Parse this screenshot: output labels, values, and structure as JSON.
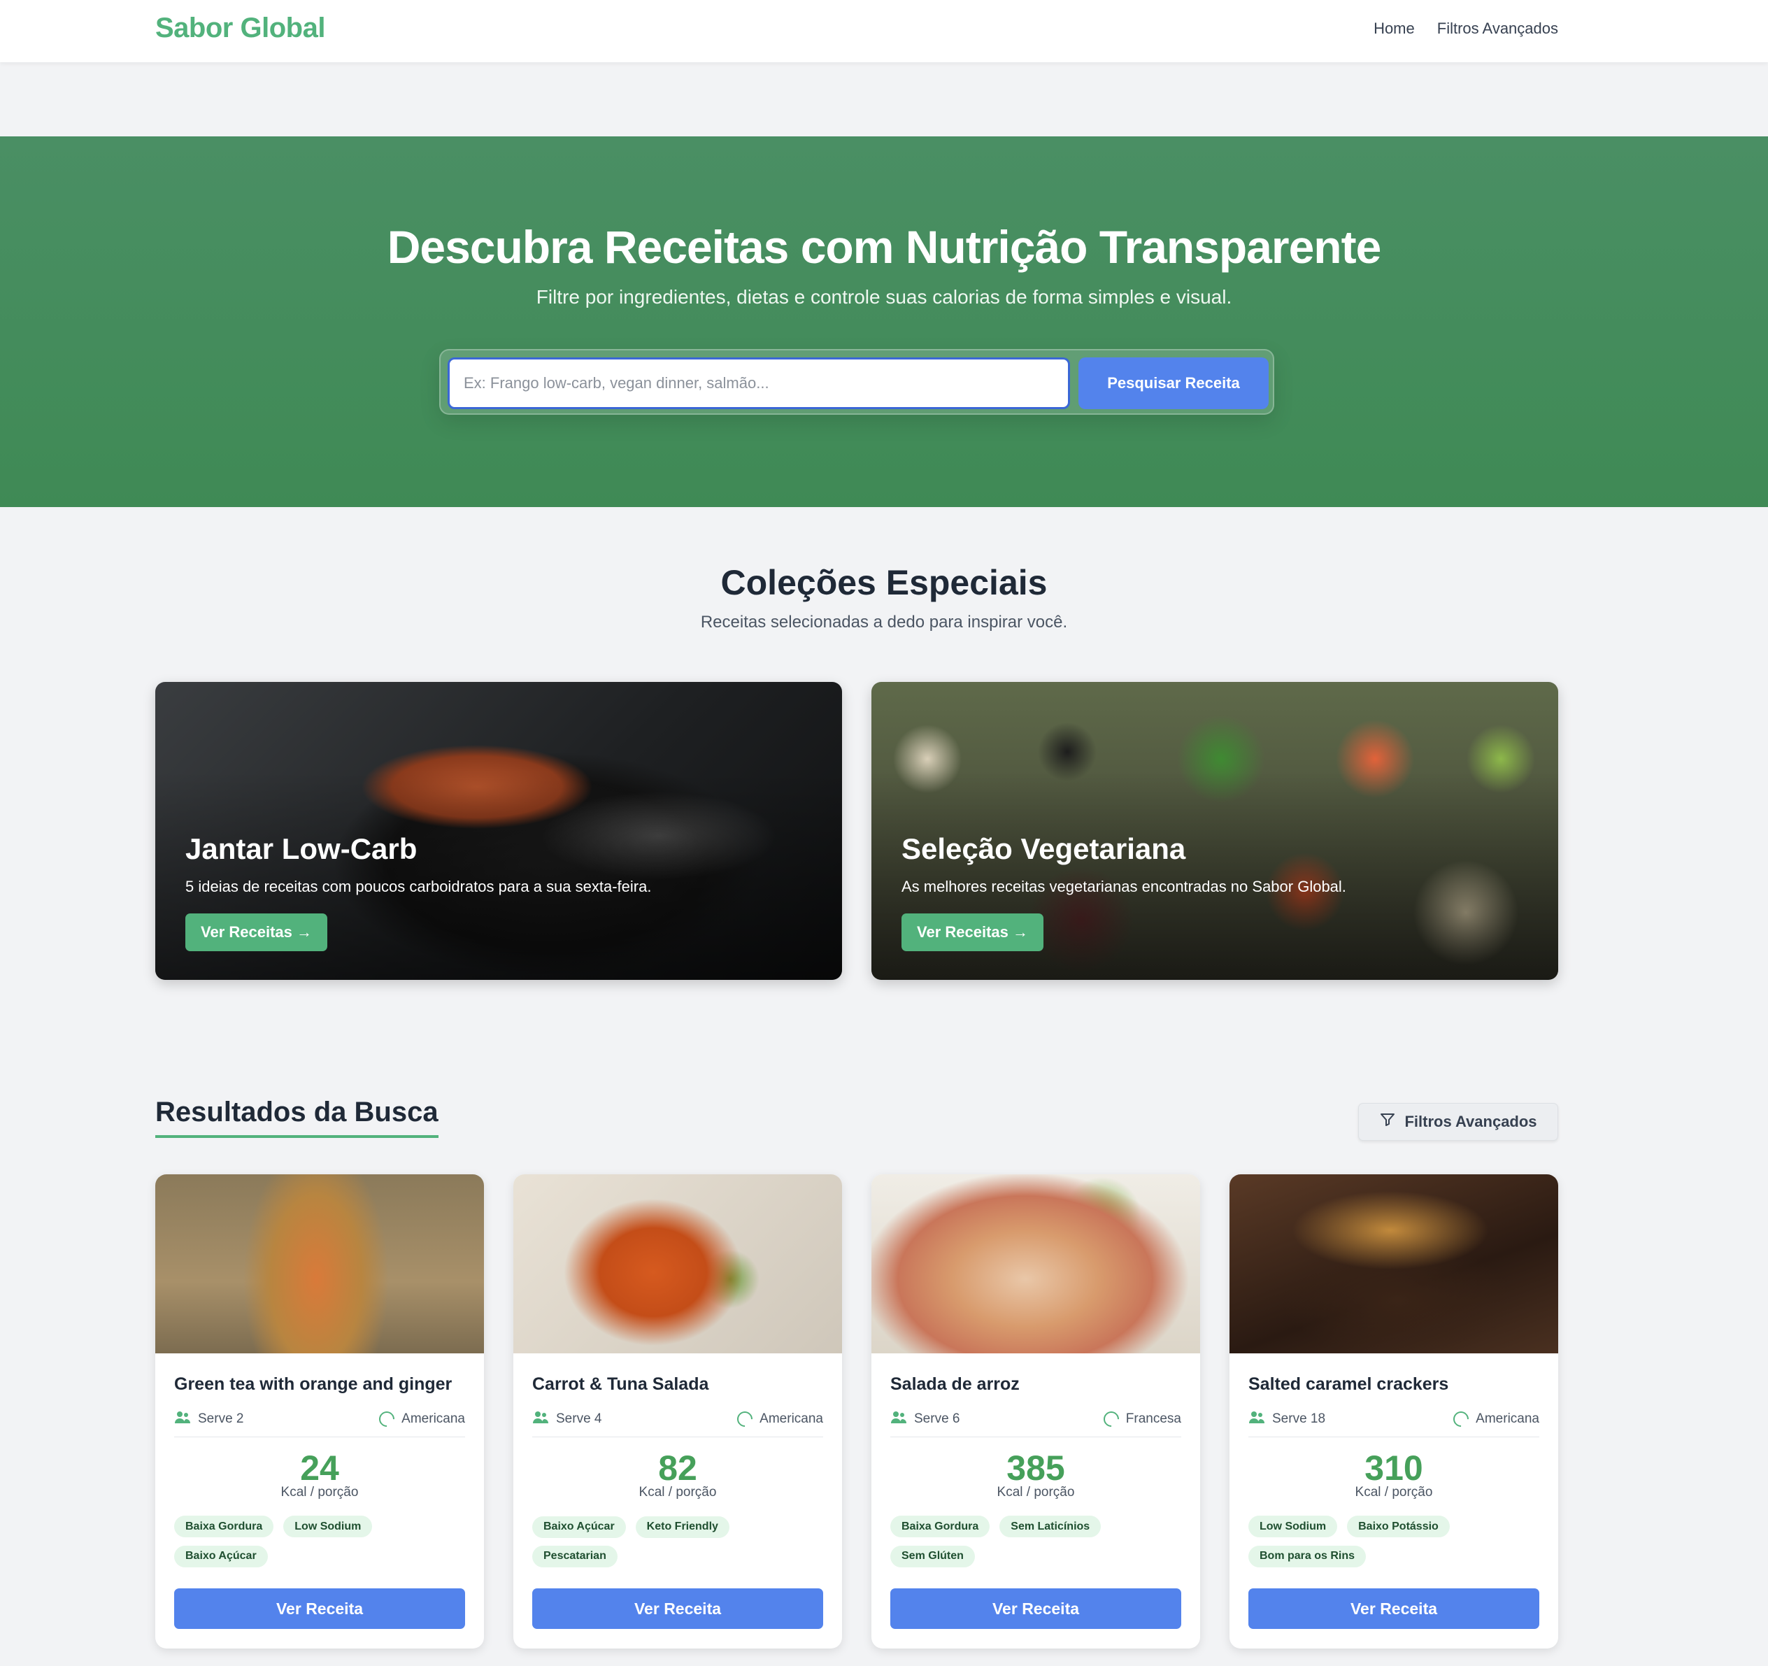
{
  "brand": "Sabor Global",
  "nav": {
    "home": "Home",
    "filters": "Filtros Avançados"
  },
  "hero": {
    "title": "Descubra Receitas com Nutrição Transparente",
    "subtitle": "Filtre por ingredientes, dietas e controle suas calorias de forma simples e visual.",
    "search_placeholder": "Ex: Frango low-carb, vegan dinner, salmão...",
    "search_value": "",
    "search_button": "Pesquisar Receita"
  },
  "collections": {
    "title": "Coleções Especiais",
    "subtitle": "Receitas selecionadas a dedo para inspirar você.",
    "items": [
      {
        "title": "Jantar Low-Carb",
        "description": "5 ideias de receitas com poucos carboidratos para a sua sexta-feira.",
        "button": "Ver Receitas →"
      },
      {
        "title": "Seleção Vegetariana",
        "description": "As melhores receitas vegetarianas encontradas no Sabor Global.",
        "button": "Ver Receitas →"
      }
    ]
  },
  "results": {
    "title": "Resultados da Busca",
    "filter_button": "Filtros Avançados",
    "cards": [
      {
        "title": "Green tea with orange and ginger",
        "serves": "Serve 2",
        "cuisine": "Americana",
        "kcal": "24",
        "kcal_label": "Kcal / porção",
        "tags": [
          "Baixa Gordura",
          "Low Sodium",
          "Baixo Açúcar"
        ],
        "button": "Ver Receita"
      },
      {
        "title": "Carrot & Tuna Salada",
        "serves": "Serve 4",
        "cuisine": "Americana",
        "kcal": "82",
        "kcal_label": "Kcal / porção",
        "tags": [
          "Baixo Açúcar",
          "Keto Friendly",
          "Pescatarian"
        ],
        "button": "Ver Receita"
      },
      {
        "title": "Salada de arroz",
        "serves": "Serve 6",
        "cuisine": "Francesa",
        "kcal": "385",
        "kcal_label": "Kcal / porção",
        "tags": [
          "Baixa Gordura",
          "Sem Laticínios",
          "Sem Glúten"
        ],
        "button": "Ver Receita"
      },
      {
        "title": "Salted caramel crackers",
        "serves": "Serve 18",
        "cuisine": "Americana",
        "kcal": "310",
        "kcal_label": "Kcal / porção",
        "tags": [
          "Low Sodium",
          "Baixo Potássio",
          "Bom para os Rins"
        ],
        "button": "Ver Receita"
      }
    ]
  },
  "colors": {
    "brand_green": "#52b27c",
    "hero_green": "#3f8a55",
    "primary_blue": "#5383ec",
    "kcal_green": "#46a05a",
    "tag_bg": "#e4f6e9"
  },
  "icons": {
    "serves": "people-icon",
    "cuisine": "ring-icon",
    "filter": "filter-icon"
  }
}
